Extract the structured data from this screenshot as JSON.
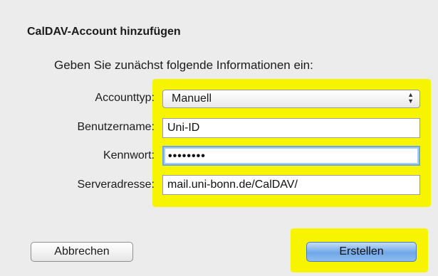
{
  "dialog": {
    "title": "CalDAV-Account hinzufügen",
    "instruction": "Geben Sie zunächst folgende Informationen ein:"
  },
  "form": {
    "account_type": {
      "label": "Accounttyp:",
      "value": "Manuell"
    },
    "username": {
      "label": "Benutzername:",
      "value": "Uni-ID"
    },
    "password": {
      "label": "Kennwort:",
      "value": "••••••••"
    },
    "server": {
      "label": "Serveradresse:",
      "value": "mail.uni-bonn.de/CalDAV/"
    }
  },
  "buttons": {
    "cancel": "Abbrechen",
    "create": "Erstellen"
  },
  "colors": {
    "highlight": "#f7f400",
    "focus_ring": "#6ea7e4",
    "primary_button": "#6fa7e8"
  }
}
